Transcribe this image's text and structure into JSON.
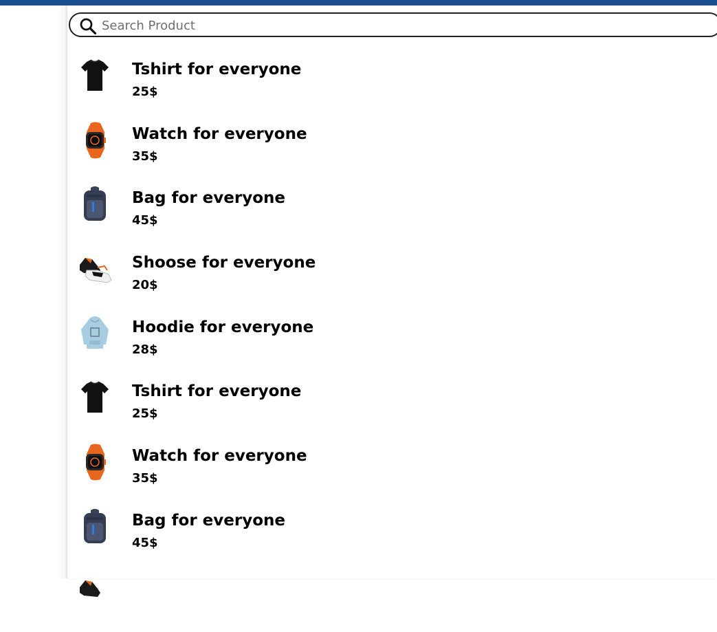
{
  "search": {
    "placeholder": "Search Product",
    "value": "",
    "icon": "search-icon"
  },
  "colors": {
    "header_bar": "#1b4e8f",
    "text": "#000000",
    "search_border": "#1f1f1f"
  },
  "products": [
    {
      "name": "Tshirt for everyone",
      "price": "25$",
      "icon": "tshirt-icon"
    },
    {
      "name": "Watch for everyone",
      "price": "35$",
      "icon": "watch-icon"
    },
    {
      "name": "Bag for everyone",
      "price": "45$",
      "icon": "bag-icon"
    },
    {
      "name": "Shoose for everyone",
      "price": "20$",
      "icon": "shoe-icon"
    },
    {
      "name": "Hoodie for everyone",
      "price": "28$",
      "icon": "hoodie-icon"
    },
    {
      "name": "Tshirt for everyone",
      "price": "25$",
      "icon": "tshirt-icon"
    },
    {
      "name": "Watch for everyone",
      "price": "35$",
      "icon": "watch-icon"
    },
    {
      "name": "Bag for everyone",
      "price": "45$",
      "icon": "bag-icon"
    }
  ]
}
